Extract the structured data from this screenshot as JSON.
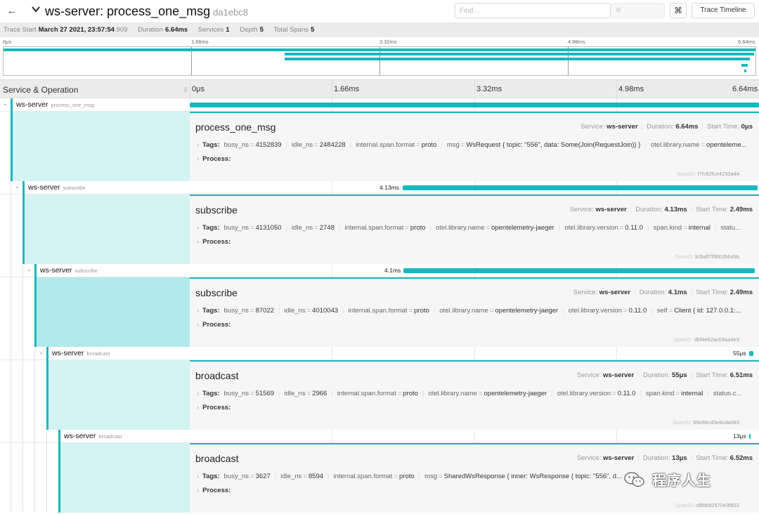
{
  "header": {
    "back_icon": "arrow-left-icon",
    "collapse_icon": "chevron-down-icon",
    "service": "ws-server",
    "sep": ": ",
    "operation": "process_one_msg",
    "trace_id": "da1ebc8",
    "find_placeholder": "Find...",
    "find_nav": "⊕",
    "shortcut_icon": "⌘",
    "timeline_button": "Trace Timeline"
  },
  "meta": {
    "trace_start_label": "Trace Start",
    "trace_start_value": "March 27 2021, 23:57:54",
    "trace_start_ms": ".909",
    "duration_label": "Duration",
    "duration_value": "6.64ms",
    "services_label": "Services",
    "services_value": "1",
    "depth_label": "Depth",
    "depth_value": "5",
    "spans_label": "Total Spans",
    "spans_value": "5"
  },
  "minimap": {
    "ticks": [
      "0μs",
      "1.66ms",
      "3.32ms",
      "4.98ms",
      "6.64ms"
    ]
  },
  "columns": {
    "service_operation": "Service & Operation",
    "grip": "||",
    "ticks": [
      "0μs",
      "1.66ms",
      "3.32ms",
      "4.98ms",
      "6.64ms"
    ]
  },
  "spans": [
    {
      "service": "ws-server",
      "operation": "process_one_msg",
      "duration_label": "",
      "detail": {
        "operation": "process_one_msg",
        "service_label": "Service:",
        "service": "ws-server",
        "duration_label": "Duration:",
        "duration": "6.64ms",
        "start_label": "Start Time:",
        "start": "0μs",
        "tags_label": "Tags:",
        "tags": [
          {
            "k": "busy_ns",
            "v": "4152839"
          },
          {
            "k": "idle_ns",
            "v": "2484228"
          },
          {
            "k": "internal.span.format",
            "v": "proto"
          },
          {
            "k": "msg",
            "v": "WsRequest { topic: \"556\", data: Some(Join(RequestJoin)) }"
          },
          {
            "k": "otel.library.name",
            "v": "openteleme..."
          }
        ],
        "process_label": "Process:",
        "spanid_label": "SpanID:",
        "spanid": "f7fc82fce4233a44"
      }
    },
    {
      "service": "ws-server",
      "operation": "subscribe",
      "duration_label": "4.13ms",
      "detail": {
        "operation": "subscribe",
        "service_label": "Service:",
        "service": "ws-server",
        "duration_label": "Duration:",
        "duration": "4.13ms",
        "start_label": "Start Time:",
        "start": "2.49ms",
        "tags_label": "Tags:",
        "tags": [
          {
            "k": "busy_ns",
            "v": "4131050"
          },
          {
            "k": "idle_ns",
            "v": "2748"
          },
          {
            "k": "internal.span.format",
            "v": "proto"
          },
          {
            "k": "otel.library.name",
            "v": "opentelemetry-jaeger"
          },
          {
            "k": "otel.library.version",
            "v": "0.11.0"
          },
          {
            "k": "span.kind",
            "v": "internal"
          },
          {
            "k": "statu...",
            "v": ""
          }
        ],
        "process_label": "Process:",
        "spanid_label": "SpanID:",
        "spanid": "b2bdf7f36035649b"
      }
    },
    {
      "service": "ws-server",
      "operation": "subscribe",
      "duration_label": "4.1ms",
      "detail": {
        "operation": "subscribe",
        "service_label": "Service:",
        "service": "ws-server",
        "duration_label": "Duration:",
        "duration": "4.1ms",
        "start_label": "Start Time:",
        "start": "2.49ms",
        "tags_label": "Tags:",
        "tags": [
          {
            "k": "busy_ns",
            "v": "87022"
          },
          {
            "k": "idle_ns",
            "v": "4010043"
          },
          {
            "k": "internal.span.format",
            "v": "proto"
          },
          {
            "k": "otel.library.name",
            "v": "opentelemetry-jaeger"
          },
          {
            "k": "otel.library.version",
            "v": "0.11.0"
          },
          {
            "k": "self",
            "v": "Client { id: 127.0.0.1:..."
          }
        ],
        "process_label": "Process:",
        "spanid_label": "SpanID:",
        "spanid": "dbf4eb2ac04aa4e3"
      }
    },
    {
      "service": "ws-server",
      "operation": "broadcast",
      "duration_label": "55μs",
      "detail": {
        "operation": "broadcast",
        "service_label": "Service:",
        "service": "ws-server",
        "duration_label": "Duration:",
        "duration": "55μs",
        "start_label": "Start Time:",
        "start": "6.51ms",
        "tags_label": "Tags:",
        "tags": [
          {
            "k": "busy_ns",
            "v": "51569"
          },
          {
            "k": "idle_ns",
            "v": "2966"
          },
          {
            "k": "internal.span.format",
            "v": "proto"
          },
          {
            "k": "otel.library.name",
            "v": "opentelemetry-jaeger"
          },
          {
            "k": "otel.library.version",
            "v": "0.11.0"
          },
          {
            "k": "span.kind",
            "v": "internal"
          },
          {
            "k": "status.c...",
            "v": ""
          }
        ],
        "process_label": "Process:",
        "spanid_label": "SpanID:",
        "spanid": "59e88c45e8cda083"
      }
    },
    {
      "service": "ws-server",
      "operation": "broadcast",
      "duration_label": "13μs",
      "detail": {
        "operation": "broadcast",
        "service_label": "Service:",
        "service": "ws-server",
        "duration_label": "Duration:",
        "duration": "13μs",
        "start_label": "Start Time:",
        "start": "6.52ms",
        "tags_label": "Tags:",
        "tags": [
          {
            "k": "busy_ns",
            "v": "3627"
          },
          {
            "k": "idle_ns",
            "v": "8594"
          },
          {
            "k": "internal.span.format",
            "v": "proto"
          },
          {
            "k": "msg",
            "v": "SharedWsResponse { inner: WsResponse { topic: \"556\", d..."
          }
        ],
        "process_label": "Process:",
        "spanid_label": "SpanID:",
        "spanid": "c8f88d257043f822"
      }
    }
  ],
  "watermark": {
    "text": "程序人生",
    "icon": "wechat-icon"
  },
  "colors": {
    "accent": "#17b8be",
    "detail_fill": "#d4f3f4"
  }
}
